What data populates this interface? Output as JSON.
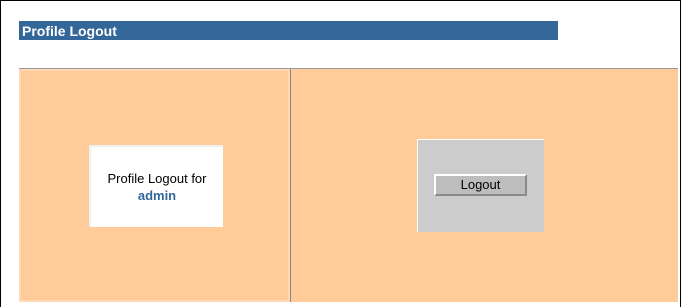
{
  "header": {
    "title": "Profile Logout"
  },
  "left_panel": {
    "label": "Profile Logout for",
    "username": "admin"
  },
  "right_panel": {
    "logout_label": "Logout"
  },
  "colors": {
    "title_bar": "#336699",
    "panel_bg": "#ffcc99",
    "button_box": "#cccccc"
  }
}
